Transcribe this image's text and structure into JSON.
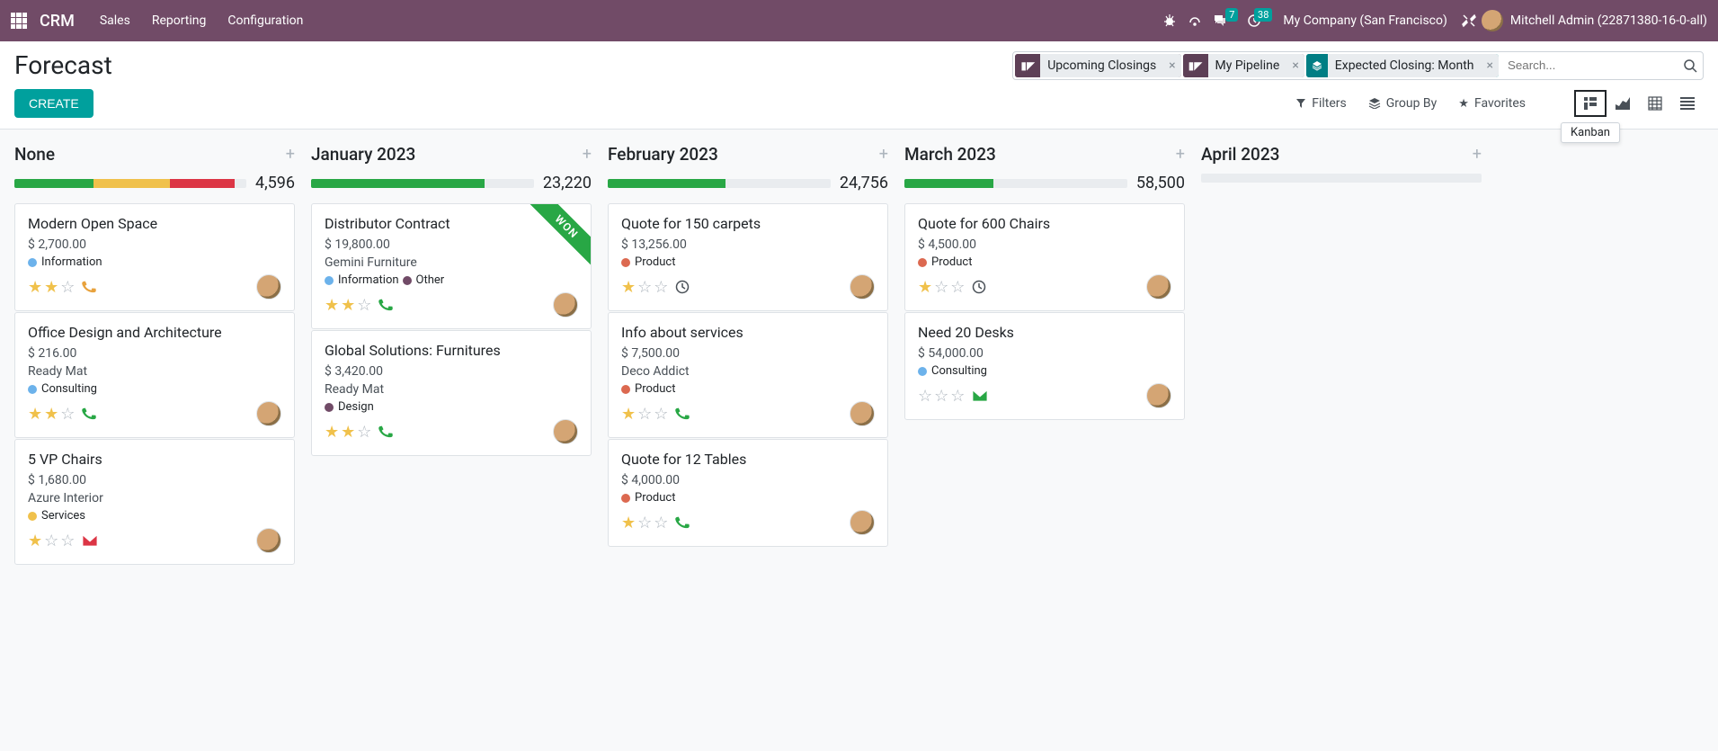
{
  "nav": {
    "brand": "CRM",
    "menus": [
      "Sales",
      "Reporting",
      "Configuration"
    ],
    "msg_badge": "7",
    "activity_badge": "38",
    "company": "My Company (San Francisco)",
    "user": "Mitchell Admin (22871380-16-0-all)"
  },
  "cp": {
    "title": "Forecast",
    "create": "CREATE",
    "facets": [
      {
        "type": "filter",
        "label": "Upcoming Closings"
      },
      {
        "type": "filter",
        "label": "My Pipeline"
      },
      {
        "type": "group",
        "label": "Expected Closing: Month"
      }
    ],
    "search_placeholder": "Search...",
    "filters": "Filters",
    "groupby": "Group By",
    "favorites": "Favorites",
    "tooltip": "Kanban"
  },
  "columns": [
    {
      "title": "None",
      "total": "4,596",
      "bar": [
        [
          "#28a745",
          34
        ],
        [
          "#f0c14b",
          33
        ],
        [
          "#dc3545",
          28
        ]
      ],
      "cards": [
        {
          "title": "Modern Open Space",
          "amount": "$ 2,700.00",
          "subtitle": "",
          "tags": [
            {
              "c": "#6cb2eb",
              "t": "Information"
            }
          ],
          "stars": 2,
          "icon": "phone-warn",
          "avatar": true
        },
        {
          "title": "Office Design and Architecture",
          "amount": "$ 216.00",
          "subtitle": "Ready Mat",
          "tags": [
            {
              "c": "#6cb2eb",
              "t": "Consulting"
            }
          ],
          "stars": 2,
          "icon": "phone",
          "avatar": true
        },
        {
          "title": "5 VP Chairs",
          "amount": "$ 1,680.00",
          "subtitle": "Azure Interior",
          "tags": [
            {
              "c": "#f0c14b",
              "t": "Services"
            }
          ],
          "stars": 1,
          "icon": "mail-warn",
          "avatar": true
        }
      ]
    },
    {
      "title": "January 2023",
      "total": "23,220",
      "bar": [
        [
          "#28a745",
          78
        ]
      ],
      "cards": [
        {
          "title": "Distributor Contract",
          "amount": "$ 19,800.00",
          "subtitle": "Gemini Furniture",
          "tags": [
            {
              "c": "#6cb2eb",
              "t": "Information"
            },
            {
              "c": "#714b67",
              "t": "Other"
            }
          ],
          "stars": 2,
          "icon": "phone",
          "avatar": true,
          "won": "WON"
        },
        {
          "title": "Global Solutions: Furnitures",
          "amount": "$ 3,420.00",
          "subtitle": "Ready Mat",
          "tags": [
            {
              "c": "#714b67",
              "t": "Design"
            }
          ],
          "stars": 2,
          "icon": "phone",
          "avatar": true
        }
      ]
    },
    {
      "title": "February 2023",
      "total": "24,756",
      "bar": [
        [
          "#28a745",
          53
        ]
      ],
      "cards": [
        {
          "title": "Quote for 150 carpets",
          "amount": "$ 13,256.00",
          "subtitle": "",
          "tags": [
            {
              "c": "#dc6950",
              "t": "Product"
            }
          ],
          "stars": 1,
          "icon": "clock",
          "avatar": true
        },
        {
          "title": "Info about services",
          "amount": "$ 7,500.00",
          "subtitle": "Deco Addict",
          "tags": [
            {
              "c": "#dc6950",
              "t": "Product"
            }
          ],
          "stars": 1,
          "icon": "phone",
          "avatar": true
        },
        {
          "title": "Quote for 12 Tables",
          "amount": "$ 4,000.00",
          "subtitle": "",
          "tags": [
            {
              "c": "#dc6950",
              "t": "Product"
            }
          ],
          "stars": 1,
          "icon": "phone",
          "avatar": true
        }
      ]
    },
    {
      "title": "March 2023",
      "total": "58,500",
      "bar": [
        [
          "#28a745",
          40
        ]
      ],
      "cards": [
        {
          "title": "Quote for 600 Chairs",
          "amount": "$ 4,500.00",
          "subtitle": "",
          "tags": [
            {
              "c": "#dc6950",
              "t": "Product"
            }
          ],
          "stars": 1,
          "icon": "clock",
          "avatar": true
        },
        {
          "title": "Need 20 Desks",
          "amount": "$ 54,000.00",
          "subtitle": "",
          "tags": [
            {
              "c": "#6cb2eb",
              "t": "Consulting"
            }
          ],
          "stars": 0,
          "icon": "mail",
          "avatar": true
        }
      ]
    },
    {
      "title": "April 2023",
      "total": "",
      "bar": [],
      "cards": []
    }
  ]
}
